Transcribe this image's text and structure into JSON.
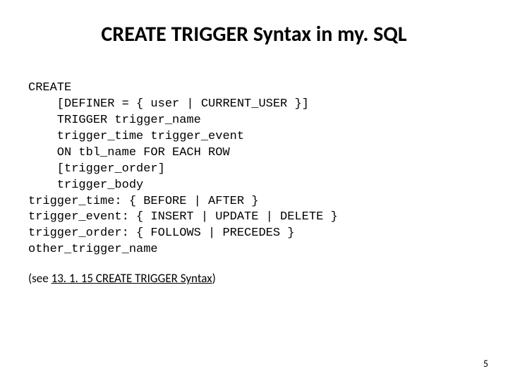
{
  "title": "CREATE TRIGGER Syntax in my. SQL",
  "code": {
    "l0": "CREATE",
    "l1": "    [DEFINER = { user | CURRENT_USER }]",
    "l2": "    TRIGGER trigger_name",
    "l3": "    trigger_time trigger_event",
    "l4": "    ON tbl_name FOR EACH ROW",
    "l5": "    [trigger_order]",
    "l6": "    trigger_body",
    "l7": "trigger_time: { BEFORE | AFTER }",
    "l8": "trigger_event: { INSERT | UPDATE | DELETE }",
    "l9": "trigger_order: { FOLLOWS | PRECEDES }",
    "l10": "other_trigger_name"
  },
  "ref": {
    "prefix": "(see ",
    "link": "13. 1. 15 CREATE TRIGGER Syntax",
    "suffix": ")"
  },
  "page_number": "5"
}
